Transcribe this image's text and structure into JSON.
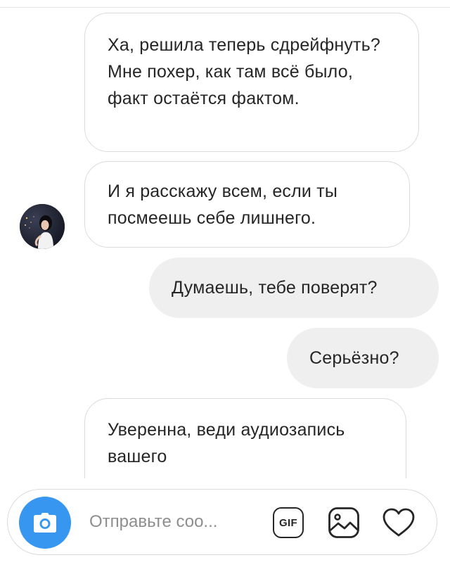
{
  "conversation": {
    "messages": [
      {
        "direction": "incoming",
        "text": "Ха, решила теперь сдрейфнуть? Мне похер, как там всё было, факт остаётся фактом."
      },
      {
        "direction": "incoming",
        "text": "И я расскажу всем, если ты посмеешь себе лишнего."
      },
      {
        "direction": "outgoing",
        "text": "Думаешь, тебе поверят?"
      },
      {
        "direction": "outgoing",
        "text": "Серьёзно?"
      },
      {
        "direction": "incoming",
        "text": "Уверенна, веди аудиозапись вашего"
      }
    ]
  },
  "composer": {
    "placeholder": "Отправьте соо...",
    "value": "",
    "gif_label": "GIF",
    "icons": {
      "camera": "camera-icon",
      "gif": "gif-icon",
      "gallery": "gallery-icon",
      "like": "heart-icon"
    }
  },
  "colors": {
    "accent": "#3797f0",
    "outgoing_bubble": "#efefef",
    "incoming_border": "#dbdbdb",
    "text": "#262626",
    "placeholder": "#8e8e8e"
  }
}
